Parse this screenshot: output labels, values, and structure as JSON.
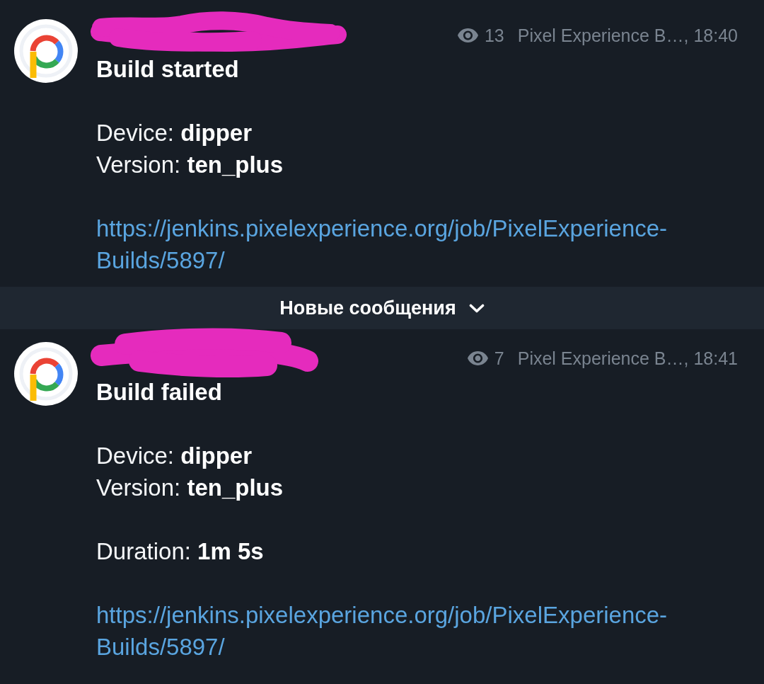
{
  "feed": [
    {
      "kind": "message",
      "sender_redacted": true,
      "views": "13",
      "signature": "Pixel Experience B…, 18:40",
      "title": "Build started",
      "paragraphs": [
        [
          "Device: **dipper**",
          "Version: **ten_plus**"
        ]
      ],
      "link": "https://jenkins.pixelexperience.org/job/PixelExperience-Builds/5897/"
    },
    {
      "kind": "unread_divider",
      "label": "Новые сообщения"
    },
    {
      "kind": "message",
      "sender_redacted": true,
      "views": "7",
      "signature": "Pixel Experience B…, 18:41",
      "title": "Build failed",
      "paragraphs": [
        [
          "Device: **dipper**",
          "Version: **ten_plus**"
        ],
        [
          "Duration: **1m 5s**"
        ]
      ],
      "link": "https://jenkins.pixelexperience.org/job/PixelExperience-Builds/5897/"
    }
  ]
}
